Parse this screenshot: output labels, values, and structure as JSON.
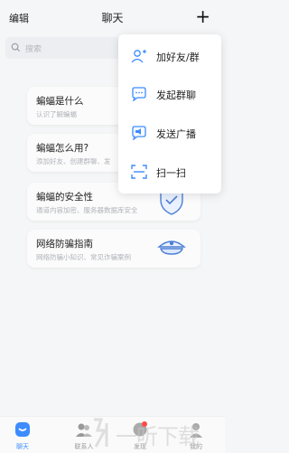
{
  "header": {
    "edit_label": "编辑",
    "title": "聊天",
    "add_symbol": "+"
  },
  "search": {
    "placeholder": "搜索"
  },
  "cards": [
    {
      "title": "蝙蝠是什么",
      "subtitle": "认识了解蝙蝠"
    },
    {
      "title": "蝙蝠怎么用?",
      "subtitle": "添加好友、创建群聊、发"
    },
    {
      "title": "蝙蝠的安全性",
      "subtitle": "通道内容加密、服务器数据库安全"
    },
    {
      "title": "网络防骗指南",
      "subtitle": "网络防骗小知识、常见诈骗案例"
    }
  ],
  "menu": [
    {
      "label": "加好友/群",
      "icon": "add-friend-icon"
    },
    {
      "label": "发起群聊",
      "icon": "group-chat-icon"
    },
    {
      "label": "发送广播",
      "icon": "broadcast-icon"
    },
    {
      "label": "扫一扫",
      "icon": "scan-icon"
    }
  ],
  "tabs": [
    {
      "label": "聊天",
      "icon": "chat-tab-icon",
      "active": true
    },
    {
      "label": "联系人",
      "icon": "contacts-tab-icon"
    },
    {
      "label": "发现",
      "icon": "discover-tab-icon"
    },
    {
      "label": "我的",
      "icon": "me-tab-icon"
    }
  ],
  "watermark": {
    "text": "一听下载"
  },
  "colors": {
    "accent": "#3c8cff",
    "background": "#f5f6f7"
  }
}
